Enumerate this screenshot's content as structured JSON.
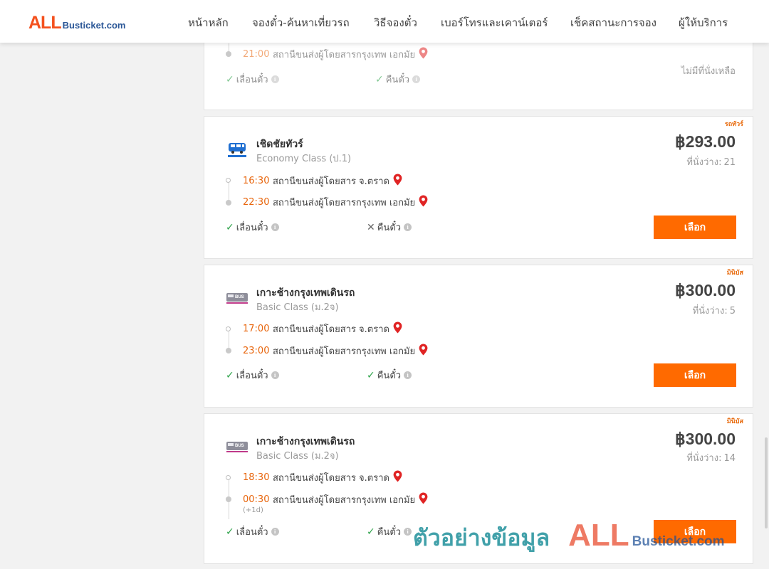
{
  "brand": {
    "logo_main": "ALL",
    "logo_rest": "Busticket.com"
  },
  "nav": [
    {
      "label": "หน้าหลัก"
    },
    {
      "label": "จองตั๋ว-ค้นหาเที่ยวรถ"
    },
    {
      "label": "วิธีจองตั๋ว"
    },
    {
      "label": "เบอร์โทรและเคาน์เตอร์"
    },
    {
      "label": "เช็คสถานะการจอง"
    },
    {
      "label": "ผู้ให้บริการ"
    }
  ],
  "partial_card": {
    "arrival_time": "21:00",
    "arrival_station": "สถานีขนส่งผู้โดยสารกรุงเทพ เอกมัย",
    "feature_change": "เลื่อนตั๋ว",
    "feature_refund": "คืนตั๋ว",
    "status": "ไม่มีที่นั่งเหลือ"
  },
  "trips": [
    {
      "badge": "รถทัวร์",
      "operator": "เชิดชัยทัวร์",
      "bus_class": "Economy Class (ป.1)",
      "price": "฿293.00",
      "seats_label": "ที่นั่งว่าง:",
      "seats": "21",
      "depart_time": "16:30",
      "depart_station": "สถานีขนส่งผู้โดยสาร จ.ตราด",
      "arrive_time": "22:30",
      "arrive_station": "สถานีขนส่งผู้โดยสารกรุงเทพ เอกมัย",
      "arrive_note": "",
      "feature_change": "เลื่อนตั๋ว",
      "change_allowed": true,
      "feature_refund": "คืนตั๋ว",
      "refund_allowed": false,
      "select_label": "เลือก"
    },
    {
      "badge": "มินิบัส",
      "operator": "เกาะช้างกรุงเทพเดินรถ",
      "bus_class": "Basic Class (ม.2จ)",
      "price": "฿300.00",
      "seats_label": "ที่นั่งว่าง:",
      "seats": "5",
      "depart_time": "17:00",
      "depart_station": "สถานีขนส่งผู้โดยสาร จ.ตราด",
      "arrive_time": "23:00",
      "arrive_station": "สถานีขนส่งผู้โดยสารกรุงเทพ เอกมัย",
      "arrive_note": "",
      "feature_change": "เลื่อนตั๋ว",
      "change_allowed": true,
      "feature_refund": "คืนตั๋ว",
      "refund_allowed": true,
      "select_label": "เลือก"
    },
    {
      "badge": "มินิบัส",
      "operator": "เกาะช้างกรุงเทพเดินรถ",
      "bus_class": "Basic Class (ม.2จ)",
      "price": "฿300.00",
      "seats_label": "ที่นั่งว่าง:",
      "seats": "14",
      "depart_time": "18:30",
      "depart_station": "สถานีขนส่งผู้โดยสาร จ.ตราด",
      "arrive_time": "00:30",
      "arrive_station": "สถานีขนส่งผู้โดยสารกรุงเทพ เอกมัย",
      "arrive_note": "(+1d)",
      "feature_change": "เลื่อนตั๋ว",
      "change_allowed": true,
      "feature_refund": "คืนตั๋ว",
      "refund_allowed": true,
      "select_label": "เลือก"
    }
  ],
  "watermark": {
    "text": "ตัวอย่างข้อมูล",
    "logo_main": "ALL",
    "logo_rest": "Busticket.com"
  },
  "icons": {
    "pin": "map-pin-icon",
    "check": "check-icon",
    "cross": "cross-icon",
    "info": "info-icon"
  },
  "colors": {
    "accent": "#ff6a00",
    "time": "#e8650c",
    "ok": "#2ea34a",
    "pin": "#e02424",
    "brand_red": "#f4511e",
    "brand_blue": "#2b5797"
  }
}
